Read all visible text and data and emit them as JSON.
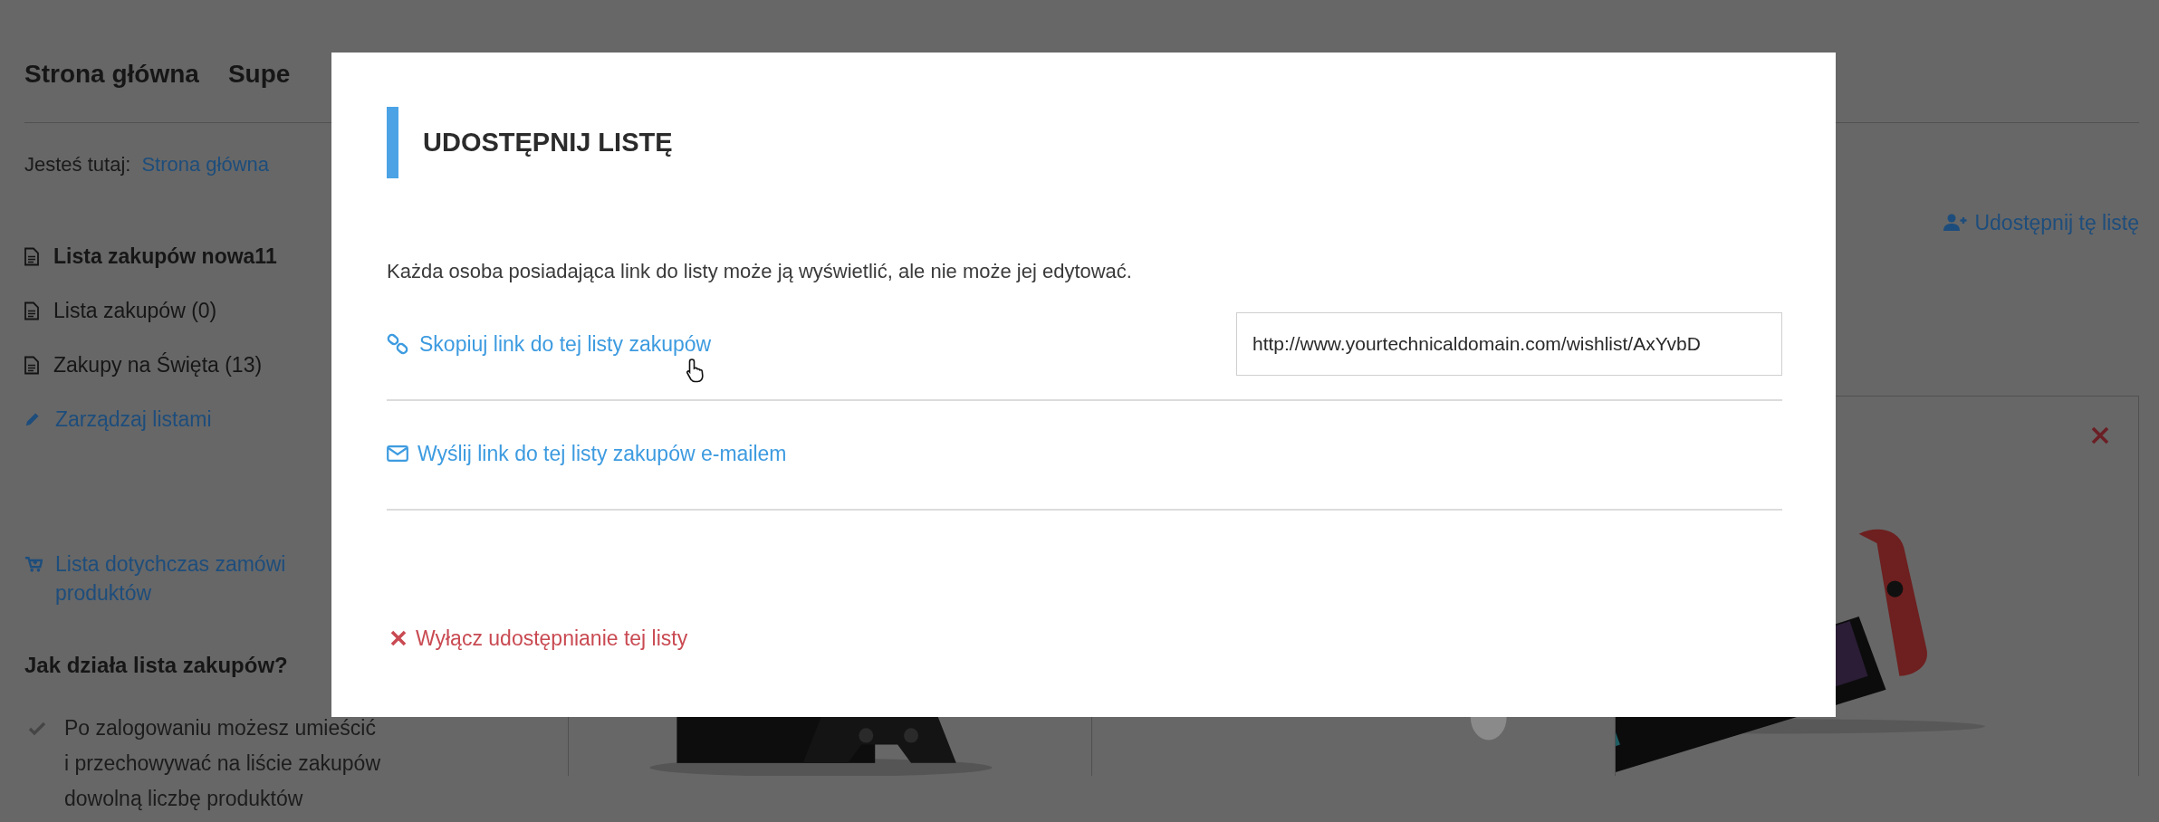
{
  "nav": [
    {
      "label": "Strona główna"
    },
    {
      "label": "Supe"
    }
  ],
  "breadcrumb": {
    "prefix": "Jesteś tutaj:",
    "items": [
      "Strona główna"
    ]
  },
  "lists": [
    {
      "label": "Lista zakupów nowa11",
      "selected": true
    },
    {
      "label": "Lista zakupów (0)",
      "selected": false
    },
    {
      "label": "Zakupy na Święta (13)",
      "selected": false
    }
  ],
  "manage_link": "Zarządzaj listami",
  "orders_link": [
    "Lista dotychczas zamówi",
    "produktów"
  ],
  "help": {
    "title": "Jak działa lista zakupów?",
    "points": [
      [
        "Po zalogowaniu możesz umieścić",
        "i przechowywać na liście zakupów",
        "dowolną liczbę produktów"
      ]
    ]
  },
  "share_link": "Udostępnij tę listę",
  "products": [
    {
      "kind": "picture"
    },
    {
      "kind": "picture"
    },
    {
      "kind": "picture"
    }
  ],
  "dialog": {
    "title": "UDOSTĘPNIJ LISTĘ",
    "description": "Każda osoba posiadająca link do listy może ją wyświetlić, ale nie może jej edytować.",
    "copy_link": "Skopiuj link do tej listy zakupów",
    "url": "http://www.yourtechnicaldomain.com/wishlist/AxYvbD",
    "email_link": "Wyślij link do tej listy zakupów e-mailem",
    "disable_link": "Wyłącz udostępnianie tej listy"
  }
}
